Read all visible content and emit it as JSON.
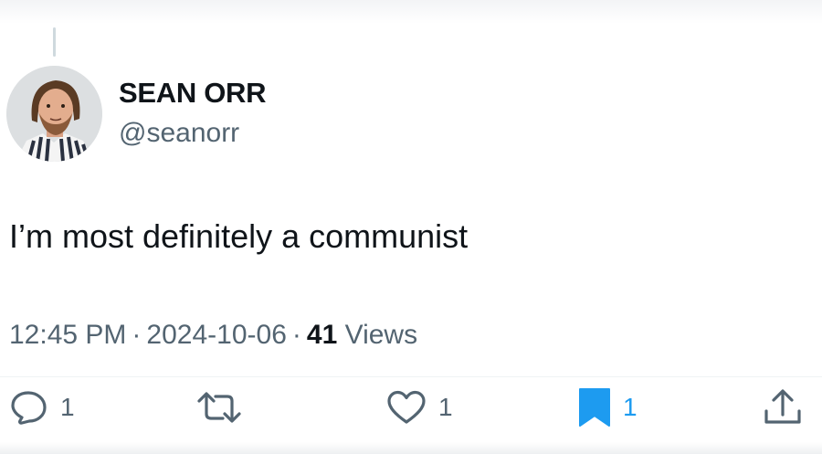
{
  "tweet": {
    "author": {
      "display_name": "SEAN ORR",
      "handle": "@seanorr"
    },
    "text": "I’m most definitely a communist",
    "meta": {
      "time": "12:45 PM",
      "date": "2024-10-06",
      "separator": "·",
      "views_count": "41",
      "views_label": "Views"
    },
    "actions": {
      "reply_count": "1",
      "retweet_count": "",
      "like_count": "1",
      "bookmark_count": "1",
      "bookmarked": true
    }
  },
  "icons": {
    "reply": "reply-icon",
    "retweet": "retweet-icon",
    "like": "heart-icon",
    "bookmark": "bookmark-icon",
    "share": "share-icon"
  },
  "colors": {
    "text_primary": "#0f1419",
    "text_secondary": "#536471",
    "accent": "#1d9bf0"
  }
}
